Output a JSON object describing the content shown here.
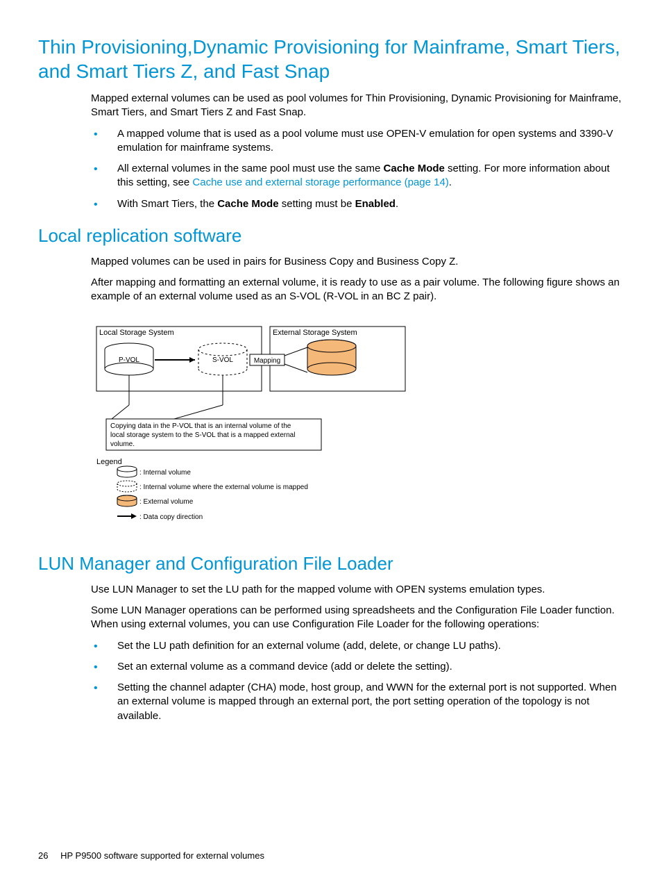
{
  "section1": {
    "heading": "Thin Provisioning,Dynamic Provisioning for Mainframe, Smart Tiers, and Smart Tiers Z, and Fast Snap",
    "para1": "Mapped external volumes can be used as pool volumes for Thin Provisioning, Dynamic Provisioning for Mainframe, Smart Tiers, and Smart Tiers Z and Fast Snap.",
    "bullets": {
      "b1": "A mapped volume that is used as a pool volume must use OPEN-V emulation for open systems and 3390-V emulation for mainframe systems.",
      "b2_pre": "All external volumes in the same pool must use the same ",
      "b2_bold": "Cache Mode",
      "b2_post": " setting. For more information about this setting, see ",
      "b2_link": "Cache use and external storage performance (page 14)",
      "b2_end": ".",
      "b3_pre": "With Smart Tiers, the ",
      "b3_bold1": "Cache Mode",
      "b3_mid": " setting must be ",
      "b3_bold2": "Enabled",
      "b3_end": "."
    }
  },
  "section2": {
    "heading": "Local replication software",
    "para1": "Mapped volumes can be used in pairs for Business Copy and Business Copy Z.",
    "para2": "After mapping and formatting an external volume, it is ready to use as a pair volume. The following figure shows an example of an external volume used as an S-VOL (R-VOL in an BC Z pair)."
  },
  "diagram": {
    "local_label": "Local Storage System",
    "external_label": "External Storage System",
    "pvol": "P-VOL",
    "svol": "S-VOL",
    "mapping": "Mapping",
    "caption_l1": "Copying data in the P-VOL that is an internal volume of the",
    "caption_l2": "local storage system to the S-VOL that is a mapped external",
    "caption_l3": "volume.",
    "legend_title": "Legend",
    "legend1": ": Internal volume",
    "legend2": ": Internal volume where the external volume is mapped",
    "legend3": ": External volume",
    "legend4": ": Data copy direction"
  },
  "section3": {
    "heading": "LUN Manager and Configuration File Loader",
    "para1": "Use LUN Manager to set the LU path for the mapped volume with OPEN systems emulation types.",
    "para2": "Some LUN Manager operations can be performed using spreadsheets and the Configuration File Loader function. When using external volumes, you can use Configuration File Loader for the following operations:",
    "bullets": {
      "b1": "Set the LU path definition for an external volume (add, delete, or change LU paths).",
      "b2": "Set an external volume as a command device (add or delete the setting).",
      "b3": "Setting the channel adapter (CHA) mode, host group, and WWN for the external port is not supported. When an external volume is mapped through an external port, the port setting operation of the topology is not available."
    }
  },
  "footer": {
    "page": "26",
    "title": "HP P9500 software supported for external volumes"
  }
}
